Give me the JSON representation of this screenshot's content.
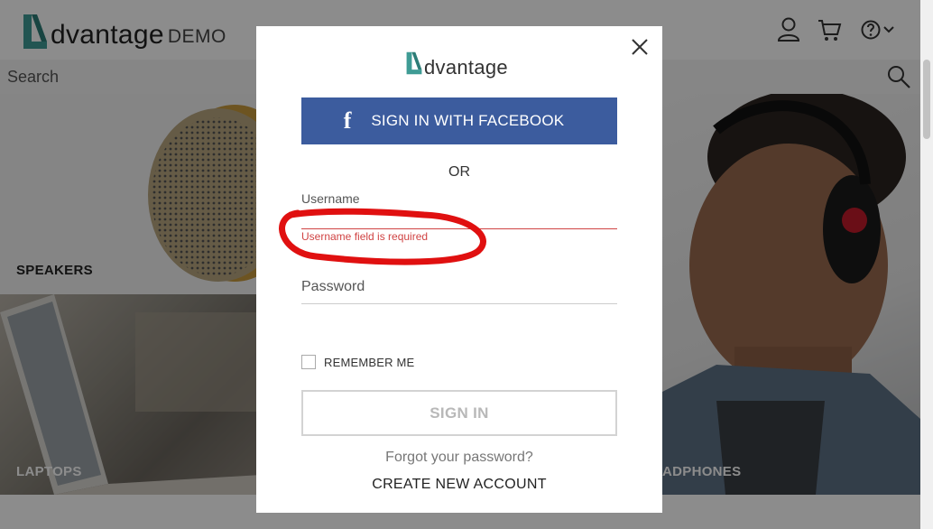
{
  "header": {
    "logo_text": "dvantage",
    "logo_sub": "DEMO"
  },
  "search": {
    "placeholder": "Search"
  },
  "tiles": {
    "speakers": "SPEAKERS",
    "laptops": "LAPTOPS",
    "headphones": "ADPHONES"
  },
  "modal": {
    "logo_text": "dvantage",
    "facebook_icon": "f",
    "facebook_label": "SIGN IN WITH FACEBOOK",
    "or_label": "OR",
    "username_label": "Username",
    "username_value": "",
    "username_error": "Username field is required",
    "password_label": "Password",
    "password_value": "",
    "remember_label": "REMEMBER ME",
    "remember_checked": false,
    "signin_label": "SIGN IN",
    "forgot_label": "Forgot your password?",
    "create_label": "CREATE NEW ACCOUNT"
  },
  "colors": {
    "brand_teal": "#3f9c95",
    "facebook_blue": "#3c5c9e",
    "error_red": "#d04343",
    "annotation_red": "#e01010"
  },
  "icons": [
    "user-icon",
    "cart-icon",
    "help-icon",
    "chevron-down-icon",
    "search-icon",
    "close-icon",
    "facebook-icon",
    "logo-mark-icon"
  ]
}
